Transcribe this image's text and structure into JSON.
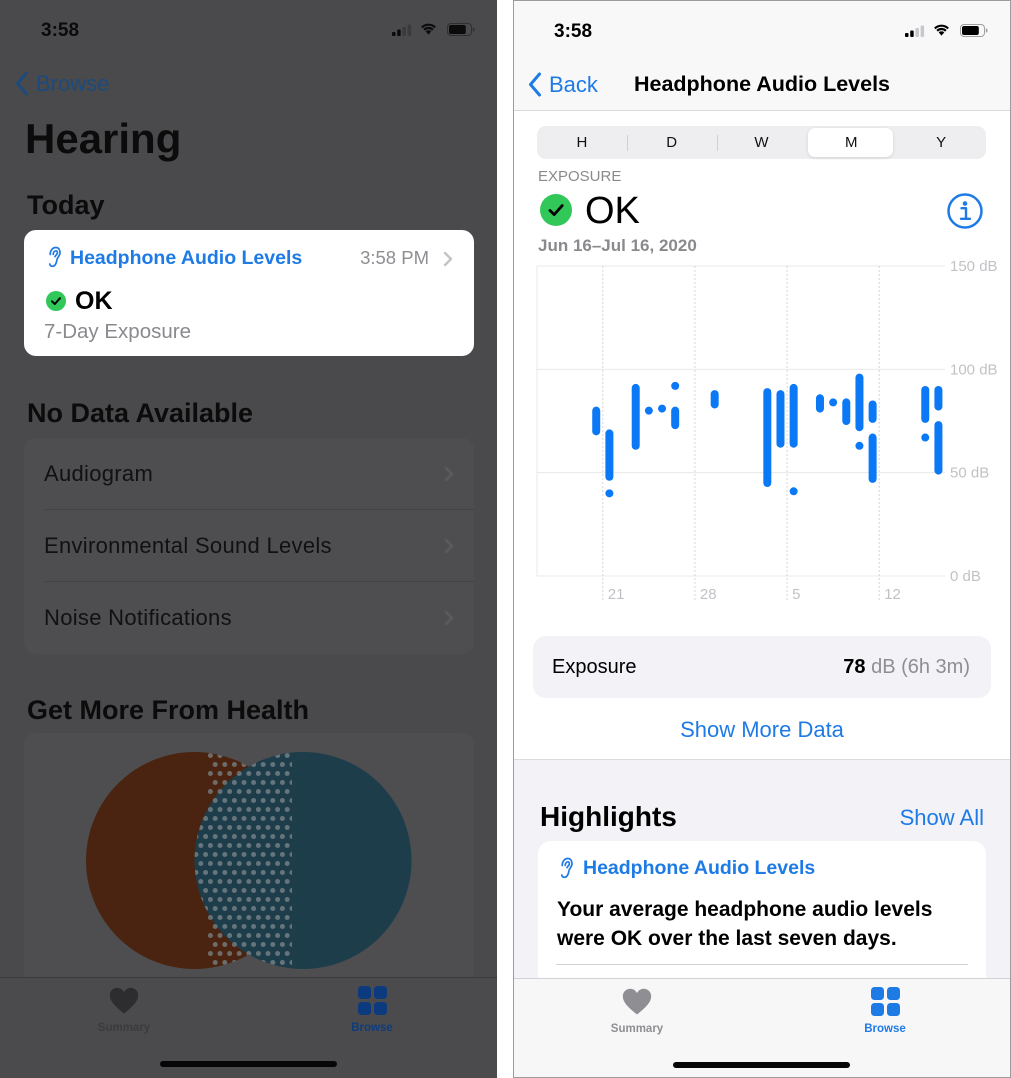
{
  "left_screen": {
    "status_bar": {
      "time": "3:58",
      "signal_bars": 2,
      "signal_bars_total": 4,
      "battery_level": 0.8
    },
    "nav": {
      "back_label": "Browse"
    },
    "title": "Hearing",
    "today": {
      "heading": "Today",
      "card": {
        "icon": "ear-icon",
        "title": "Headphone Audio Levels",
        "time": "3:58 PM",
        "status_icon": "checkmark-circle-icon",
        "status": "OK",
        "subtitle": "7-Day Exposure"
      }
    },
    "no_data": {
      "heading": "No Data Available",
      "items": [
        {
          "label": "Audiogram"
        },
        {
          "label": "Environmental Sound Levels"
        },
        {
          "label": "Noise Notifications"
        }
      ]
    },
    "get_more": {
      "heading": "Get More From Health",
      "illustration": "venn-diagram"
    },
    "tab_bar": {
      "tabs": [
        {
          "label": "Summary",
          "icon": "heart-icon",
          "selected": false
        },
        {
          "label": "Browse",
          "icon": "grid-icon",
          "selected": true
        }
      ]
    }
  },
  "right_screen": {
    "status_bar": {
      "time": "3:58",
      "signal_bars": 2,
      "signal_bars_total": 4,
      "battery_level": 0.8
    },
    "nav": {
      "back_label": "Back",
      "title": "Headphone Audio Levels"
    },
    "segmented": {
      "options": [
        "H",
        "D",
        "W",
        "M",
        "Y"
      ],
      "selected": "M"
    },
    "summary": {
      "label": "EXPOSURE",
      "status_icon": "checkmark-circle-icon",
      "status": "OK",
      "info_icon": "info-icon",
      "date_range": "Jun 16–Jul 16, 2020"
    },
    "exposure_row": {
      "label": "Exposure",
      "value": "78",
      "unit_and_duration": " dB (6h 3m)"
    },
    "show_more_label": "Show More Data",
    "highlights": {
      "heading": "Highlights",
      "show_all_label": "Show All",
      "card": {
        "icon": "ear-icon",
        "title": "Headphone Audio Levels",
        "body": "Your average headphone audio levels were OK over the last seven days."
      }
    },
    "tab_bar": {
      "tabs": [
        {
          "label": "Summary",
          "icon": "heart-icon",
          "selected": false
        },
        {
          "label": "Browse",
          "icon": "grid-icon",
          "selected": true
        }
      ]
    }
  },
  "colors": {
    "accent": "#1e7be6",
    "ok_green": "#32c759",
    "chart_bar": "#0b78f5",
    "secondary_text": "#8a8a8e"
  },
  "chart_data": {
    "type": "bar",
    "bar_style": "range",
    "title": "",
    "xlabel": "",
    "ylabel": "dB",
    "x_range": [
      "2020-06-16",
      "2020-07-17"
    ],
    "x_ticks": [
      {
        "date": "2020-06-21",
        "label": "21"
      },
      {
        "date": "2020-06-28",
        "label": "28"
      },
      {
        "date": "2020-07-05",
        "label": "5"
      },
      {
        "date": "2020-07-12",
        "label": "12"
      }
    ],
    "ylim": [
      0,
      150
    ],
    "y_ticks": [
      {
        "value": 150,
        "label": "150 dB"
      },
      {
        "value": 100,
        "label": "100 dB"
      },
      {
        "value": 50,
        "label": "50 dB"
      },
      {
        "value": 0,
        "label": "0 dB"
      }
    ],
    "grid": true,
    "legend": "none",
    "series": [
      {
        "name": "Headphone Audio Levels",
        "color": "#0b78f5",
        "ranges": [
          {
            "date": "2020-06-20",
            "min": 70,
            "max": 80
          },
          {
            "date": "2020-06-21",
            "min": 48,
            "max": 69
          },
          {
            "date": "2020-06-21",
            "min": 40,
            "max": 40
          },
          {
            "date": "2020-06-23",
            "min": 63,
            "max": 91
          },
          {
            "date": "2020-06-24",
            "min": 80,
            "max": 80
          },
          {
            "date": "2020-06-25",
            "min": 81,
            "max": 81
          },
          {
            "date": "2020-06-26",
            "min": 92,
            "max": 92
          },
          {
            "date": "2020-06-26",
            "min": 73,
            "max": 80
          },
          {
            "date": "2020-06-29",
            "min": 83,
            "max": 88
          },
          {
            "date": "2020-07-03",
            "min": 45,
            "max": 89
          },
          {
            "date": "2020-07-04",
            "min": 64,
            "max": 88
          },
          {
            "date": "2020-07-05",
            "min": 64,
            "max": 91
          },
          {
            "date": "2020-07-05",
            "min": 41,
            "max": 41
          },
          {
            "date": "2020-07-07",
            "min": 81,
            "max": 86
          },
          {
            "date": "2020-07-08",
            "min": 84,
            "max": 84
          },
          {
            "date": "2020-07-09",
            "min": 75,
            "max": 84
          },
          {
            "date": "2020-07-10",
            "min": 72,
            "max": 96
          },
          {
            "date": "2020-07-10",
            "min": 63,
            "max": 63
          },
          {
            "date": "2020-07-11",
            "min": 76,
            "max": 83
          },
          {
            "date": "2020-07-11",
            "min": 47,
            "max": 67
          },
          {
            "date": "2020-07-15",
            "min": 76,
            "max": 90
          },
          {
            "date": "2020-07-15",
            "min": 67,
            "max": 67
          },
          {
            "date": "2020-07-16",
            "min": 82,
            "max": 90
          },
          {
            "date": "2020-07-16",
            "min": 51,
            "max": 73
          }
        ]
      }
    ]
  }
}
